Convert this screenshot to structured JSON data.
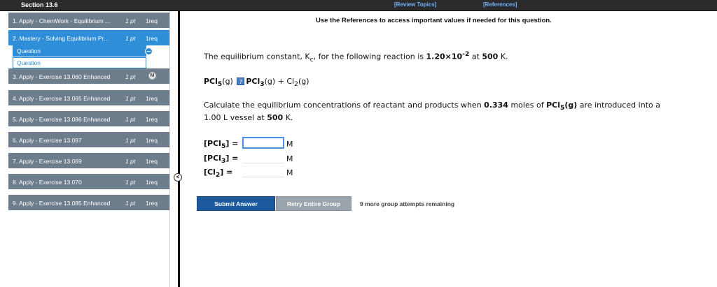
{
  "topbar": {
    "section_title": "Section 13.6",
    "review_topics": "[Review Topics]",
    "references": "[References]"
  },
  "sidebar": {
    "items": [
      {
        "title": "1. Apply - ChemWork - Equilibrium ...",
        "points": "1 pt",
        "req": "1req",
        "active": false
      },
      {
        "title": "2. Mastery - Solving Equilibrium Pr...",
        "points": "1 pt",
        "req": "1req",
        "active": true
      },
      {
        "title": "3. Apply - Exercise 13.060 Enhanced",
        "points": "1 pt",
        "req": "",
        "badge": "M",
        "active": false
      },
      {
        "title": "4. Apply - Exercise 13.065 Enhanced",
        "points": "1 pt",
        "req": "1req",
        "active": false
      },
      {
        "title": "5. Apply - Exercise 13.086 Enhanced",
        "points": "1 pt",
        "req": "1req",
        "active": false
      },
      {
        "title": "6. Apply - Exercise 13.087",
        "points": "1 pt",
        "req": "1req",
        "active": false
      },
      {
        "title": "7. Apply - Exercise 13.069",
        "points": "1 pt",
        "req": "1req",
        "active": false
      },
      {
        "title": "8. Apply - Exercise 13.070",
        "points": "1 pt",
        "req": "1req",
        "active": false
      },
      {
        "title": "9. Apply - Exercise 13.085 Enhanced",
        "points": "1 pt",
        "req": "1req",
        "active": false
      }
    ],
    "subitems": [
      "Question",
      "Question"
    ],
    "collapse_glyph": "<"
  },
  "main": {
    "reference_note": "Use the References to access important values if needed for this question.",
    "eq_pre": "The equilibrium constant, K",
    "eq_sub": "c",
    "eq_mid": ", for the following reaction is ",
    "eq_value": "1.20×10",
    "eq_exp": "-2",
    "eq_at": " at ",
    "eq_temp": "500",
    "eq_unit": " K.",
    "reaction": {
      "r1": "PCl",
      "r1_sub": "5",
      "r1_state": "(g)",
      "arrow_glyph": "?",
      "p1": "PCl",
      "p1_sub": "3",
      "p1_state": "(g) + ",
      "p2": "Cl",
      "p2_sub": "2",
      "p2_state": "(g)"
    },
    "calc_pre": "Calculate the equilibrium concentrations of reactant and products when ",
    "calc_moles": "0.334",
    "calc_mid": " moles of ",
    "calc_species": "PCl",
    "calc_species_sub": "5",
    "calc_species_state": "(g)",
    "calc_post": " are introduced into a",
    "calc_line2_pre": "1.00 L vessel at ",
    "calc_line2_temp": "500",
    "calc_line2_unit": " K.",
    "answers": [
      {
        "label_pre": "[PCl",
        "label_sub": "5",
        "label_post": "] =",
        "value": "",
        "unit": "M"
      },
      {
        "label_pre": "[PCl",
        "label_sub": "3",
        "label_post": "] =",
        "value": "",
        "unit": "M"
      },
      {
        "label_pre": "[Cl",
        "label_sub": "2",
        "label_post": "]  =",
        "value": "",
        "unit": "M"
      }
    ],
    "submit_label": "Submit Answer",
    "retry_label": "Retry Entire Group",
    "attempts_text": "9 more group attempts remaining"
  }
}
